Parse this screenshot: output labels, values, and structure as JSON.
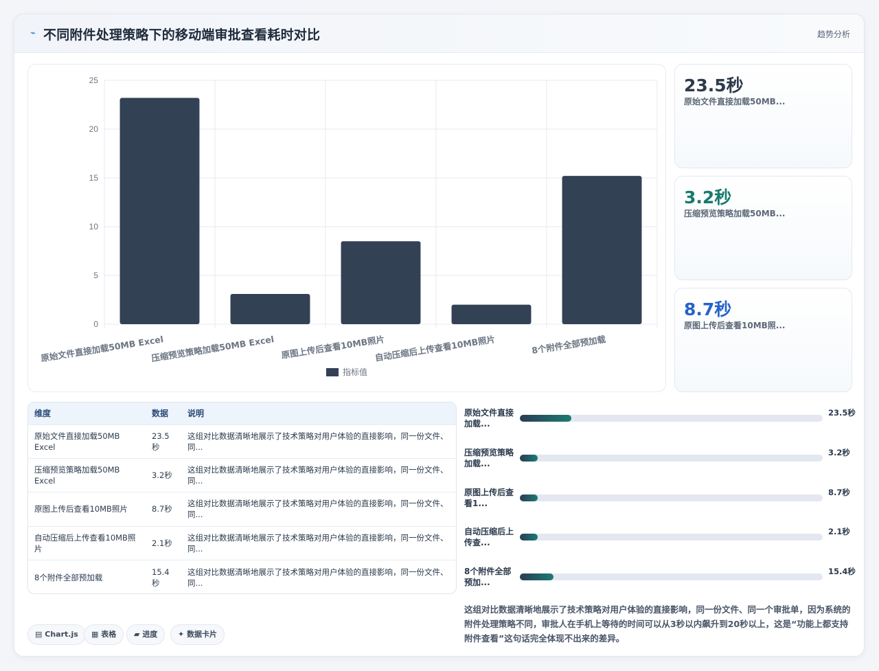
{
  "header": {
    "icon": "trend-icon",
    "title": "不同附件处理策略下的移动端审批查看耗时对比",
    "trend_label": "趋势分析"
  },
  "chart_data": {
    "type": "bar",
    "categories": [
      "原始文件直接加载50MB Excel",
      "压缩预览策略加载50MB Excel",
      "原图上传后查看10MB照片",
      "自动压缩后上传查看10MB照片",
      "8个附件全部预加载"
    ],
    "series": [
      {
        "name": "指标值",
        "values": [
          23.2,
          3.1,
          8.5,
          2.0,
          15.2
        ],
        "color": "#334155"
      }
    ],
    "ylim": [
      0,
      25
    ],
    "yticks": [
      0,
      5,
      10,
      15,
      20,
      25
    ],
    "grid": true,
    "legend": "bottom"
  },
  "stats": [
    {
      "value": "23.5秒",
      "label": "原始文件直接加载50MB...",
      "color": "#2d3a4b"
    },
    {
      "value": "3.2秒",
      "label": "压缩预览策略加载50MB...",
      "color": "#177a6e"
    },
    {
      "value": "8.7秒",
      "label": "原图上传后查看10MB照...",
      "color": "#2563c9"
    }
  ],
  "table": {
    "headers": [
      "维度",
      "数据",
      "说明"
    ],
    "rows": [
      {
        "dim": "原始文件直接加载50MB Excel",
        "data": "23.5秒",
        "desc": "这组对比数据清晰地展示了技术策略对用户体验的直接影响，同一份文件、同..."
      },
      {
        "dim": "压缩预览策略加载50MB Excel",
        "data": "3.2秒",
        "desc": "这组对比数据清晰地展示了技术策略对用户体验的直接影响，同一份文件、同..."
      },
      {
        "dim": "原图上传后查看10MB照片",
        "data": "8.7秒",
        "desc": "这组对比数据清晰地展示了技术策略对用户体验的直接影响，同一份文件、同..."
      },
      {
        "dim": "自动压缩后上传查看10MB照片",
        "data": "2.1秒",
        "desc": "这组对比数据清晰地展示了技术策略对用户体验的直接影响，同一份文件、同..."
      },
      {
        "dim": "8个附件全部预加载",
        "data": "15.4秒",
        "desc": "这组对比数据清晰地展示了技术策略对用户体验的直接影响，同一份文件、同..."
      }
    ]
  },
  "progress": [
    {
      "label": "原始文件直接加载...",
      "value": "23.5秒",
      "pct": 17
    },
    {
      "label": "压缩预览策略加载...",
      "value": "3.2秒",
      "pct": 6
    },
    {
      "label": "原图上传后查看1...",
      "value": "8.7秒",
      "pct": 6
    },
    {
      "label": "自动压缩后上传查...",
      "value": "2.1秒",
      "pct": 6
    },
    {
      "label": "8个附件全部预加...",
      "value": "15.4秒",
      "pct": 11
    }
  ],
  "summary": "这组对比数据清晰地展示了技术策略对用户体验的直接影响，同一份文件、同一个审批单，因为系统的附件处理策略不同，审批人在手机上等待的时间可以从3秒以内飙升到20秒以上，这是“功能上都支持附件查看”这句话完全体现不出来的差异。",
  "tags": [
    {
      "icon": "chart-icon",
      "glyph": "▤",
      "label": "Chart.js"
    },
    {
      "icon": "table-icon",
      "glyph": "▦",
      "label": "表格"
    },
    {
      "icon": "progress-icon",
      "glyph": "▰",
      "label": "进度"
    },
    {
      "icon": "card-icon",
      "glyph": "✦",
      "label": "数据卡片"
    }
  ]
}
